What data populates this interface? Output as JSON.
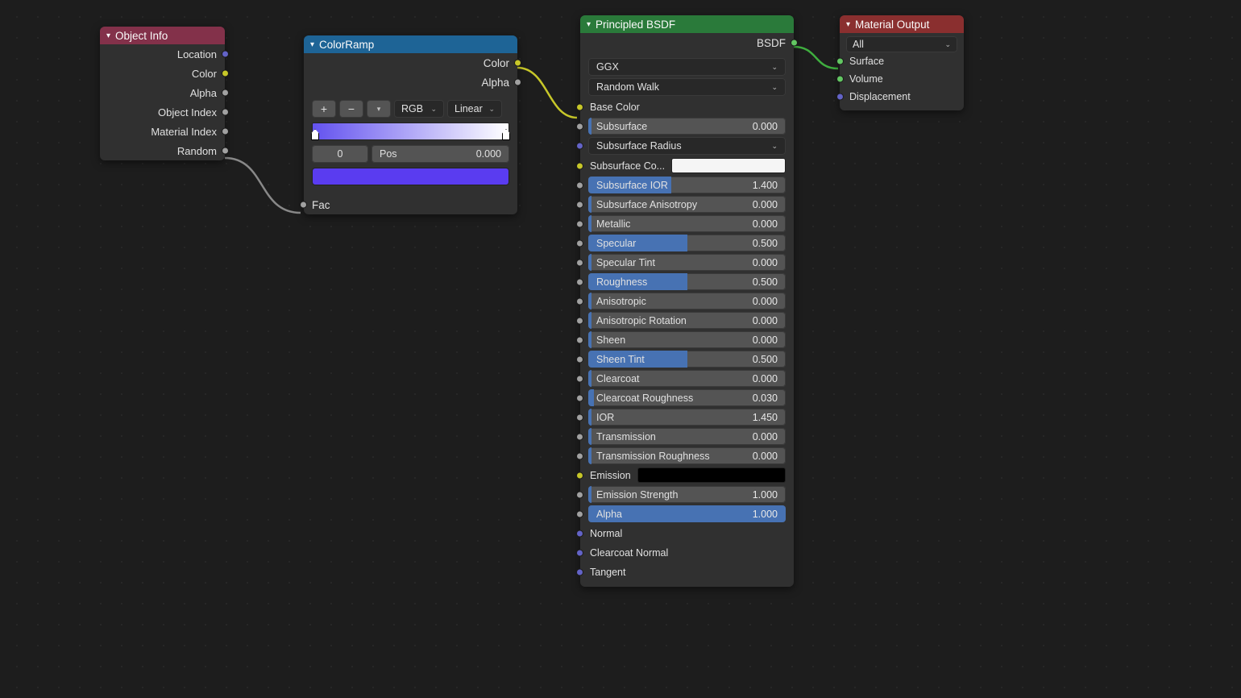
{
  "object_info": {
    "title": "Object Info",
    "outputs": {
      "location": "Location",
      "color": "Color",
      "alpha": "Alpha",
      "object_index": "Object Index",
      "material_index": "Material Index",
      "random": "Random"
    }
  },
  "color_ramp": {
    "title": "ColorRamp",
    "out_color": "Color",
    "out_alpha": "Alpha",
    "mode": "RGB",
    "interp": "Linear",
    "stop_index": "0",
    "pos_label": "Pos",
    "pos_value": "0.000",
    "stop0_color": "#6352ef",
    "stop1_color": "#ffffff",
    "swatch_color": "#5a3cf0",
    "fac_label": "Fac"
  },
  "bsdf": {
    "title": "Principled BSDF",
    "out_bsdf": "BSDF",
    "distribution": "GGX",
    "subsurface_method": "Random Walk",
    "base_color_label": "Base Color",
    "subsurface_color_label": "Subsurface Co...",
    "subsurface_color": "#f5f5f5",
    "emission_label": "Emission",
    "emission_color": "#000000",
    "subsurface_radius_label": "Subsurface Radius",
    "props": {
      "subsurface": {
        "label": "Subsurface",
        "value": "0.000",
        "fill": 0.0,
        "bar": true
      },
      "subsurface_ior": {
        "label": "Subsurface IOR",
        "value": "1.400",
        "fill": 0.42,
        "bar": false
      },
      "subsurface_anisotropy": {
        "label": "Subsurface Anisotropy",
        "value": "0.000",
        "fill": 0.0,
        "bar": true
      },
      "metallic": {
        "label": "Metallic",
        "value": "0.000",
        "fill": 0.0,
        "bar": true
      },
      "specular": {
        "label": "Specular",
        "value": "0.500",
        "fill": 0.5,
        "bar": false
      },
      "specular_tint": {
        "label": "Specular Tint",
        "value": "0.000",
        "fill": 0.0,
        "bar": true
      },
      "roughness": {
        "label": "Roughness",
        "value": "0.500",
        "fill": 0.5,
        "bar": false
      },
      "anisotropic": {
        "label": "Anisotropic",
        "value": "0.000",
        "fill": 0.0,
        "bar": true
      },
      "anisotropic_rotation": {
        "label": "Anisotropic Rotation",
        "value": "0.000",
        "fill": 0.0,
        "bar": true
      },
      "sheen": {
        "label": "Sheen",
        "value": "0.000",
        "fill": 0.0,
        "bar": true
      },
      "sheen_tint": {
        "label": "Sheen Tint",
        "value": "0.500",
        "fill": 0.5,
        "bar": false
      },
      "clearcoat": {
        "label": "Clearcoat",
        "value": "0.000",
        "fill": 0.0,
        "bar": true
      },
      "clearcoat_roughness": {
        "label": "Clearcoat Roughness",
        "value": "0.030",
        "fill": 0.03,
        "bar": true
      },
      "ior": {
        "label": "IOR",
        "value": "1.450",
        "fill": 0.0,
        "bar": true
      },
      "transmission": {
        "label": "Transmission",
        "value": "0.000",
        "fill": 0.0,
        "bar": true
      },
      "transmission_roughness": {
        "label": "Transmission Roughness",
        "value": "0.000",
        "fill": 0.0,
        "bar": true
      },
      "emission_strength": {
        "label": "Emission Strength",
        "value": "1.000",
        "fill": 0.0,
        "bar": true
      },
      "alpha": {
        "label": "Alpha",
        "value": "1.000",
        "fill": 1.0,
        "bar": false
      }
    },
    "links": {
      "normal": "Normal",
      "clearcoat_normal": "Clearcoat Normal",
      "tangent": "Tangent"
    }
  },
  "output": {
    "title": "Material Output",
    "target": "All",
    "surface": "Surface",
    "volume": "Volume",
    "displacement": "Displacement"
  }
}
